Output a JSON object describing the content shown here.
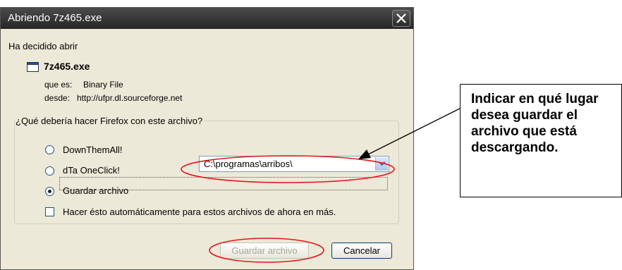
{
  "dialog": {
    "title": "Abriendo 7z465.exe",
    "intro": "Ha decidido abrir",
    "file_name": "7z465.exe",
    "type_label": "que es:",
    "type_value": "Binary File",
    "from_label": "desde:",
    "from_value": "http://ufpr.dl.sourceforge.net",
    "question": "¿Qué debería hacer Firefox con este archivo?",
    "options": [
      {
        "label": "DownThemAll!",
        "selected": false
      },
      {
        "label": "dTa OneClick!",
        "selected": false
      },
      {
        "label": "Guardar archivo",
        "selected": true
      }
    ],
    "save_path": "C:\\programas\\arribos\\",
    "auto_label": "Hacer ésto automáticamente para estos archivos de ahora en más.",
    "auto_checked": false,
    "save_button": "Guardar archivo",
    "cancel_button": "Cancelar"
  },
  "annotation": {
    "text": "Indicar en qué lugar desea guardar el archivo que está descargando.",
    "highlight_color": "#e8141c"
  }
}
